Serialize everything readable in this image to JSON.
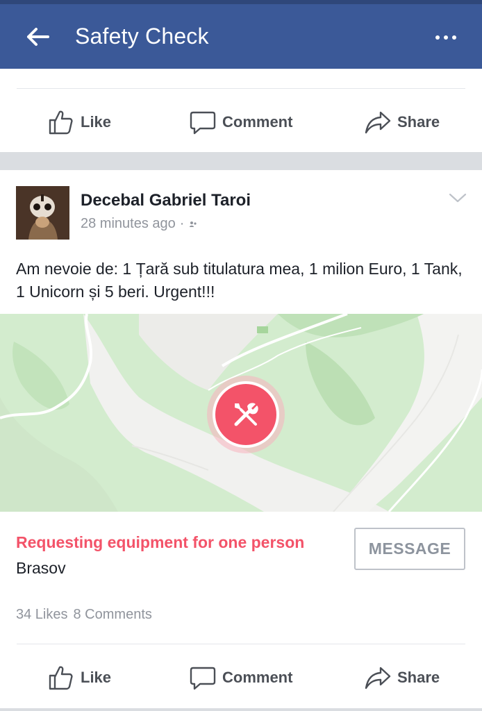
{
  "header": {
    "title": "Safety Check",
    "back_icon": "arrow-left-icon",
    "menu_icon": "more-dots-icon"
  },
  "actions": {
    "like": "Like",
    "comment": "Comment",
    "share": "Share"
  },
  "post": {
    "author": "Decebal Gabriel Taroi",
    "time": "28 minutes ago",
    "separator": "·",
    "text": "Am nevoie de: 1 Țară sub titulatura mea, 1 milion Euro, 1 Tank, 1 Unicorn și 5 beri. Urgent!!!",
    "request_title": "Requesting equipment for one person",
    "location": "Brasov",
    "message_button": "MESSAGE",
    "likes": "34 Likes",
    "comments": "8 Comments"
  },
  "colors": {
    "brand": "#3b5998",
    "accent": "#f35369",
    "map_green": "#c9e9c4",
    "map_gray": "#f1f1ef"
  }
}
